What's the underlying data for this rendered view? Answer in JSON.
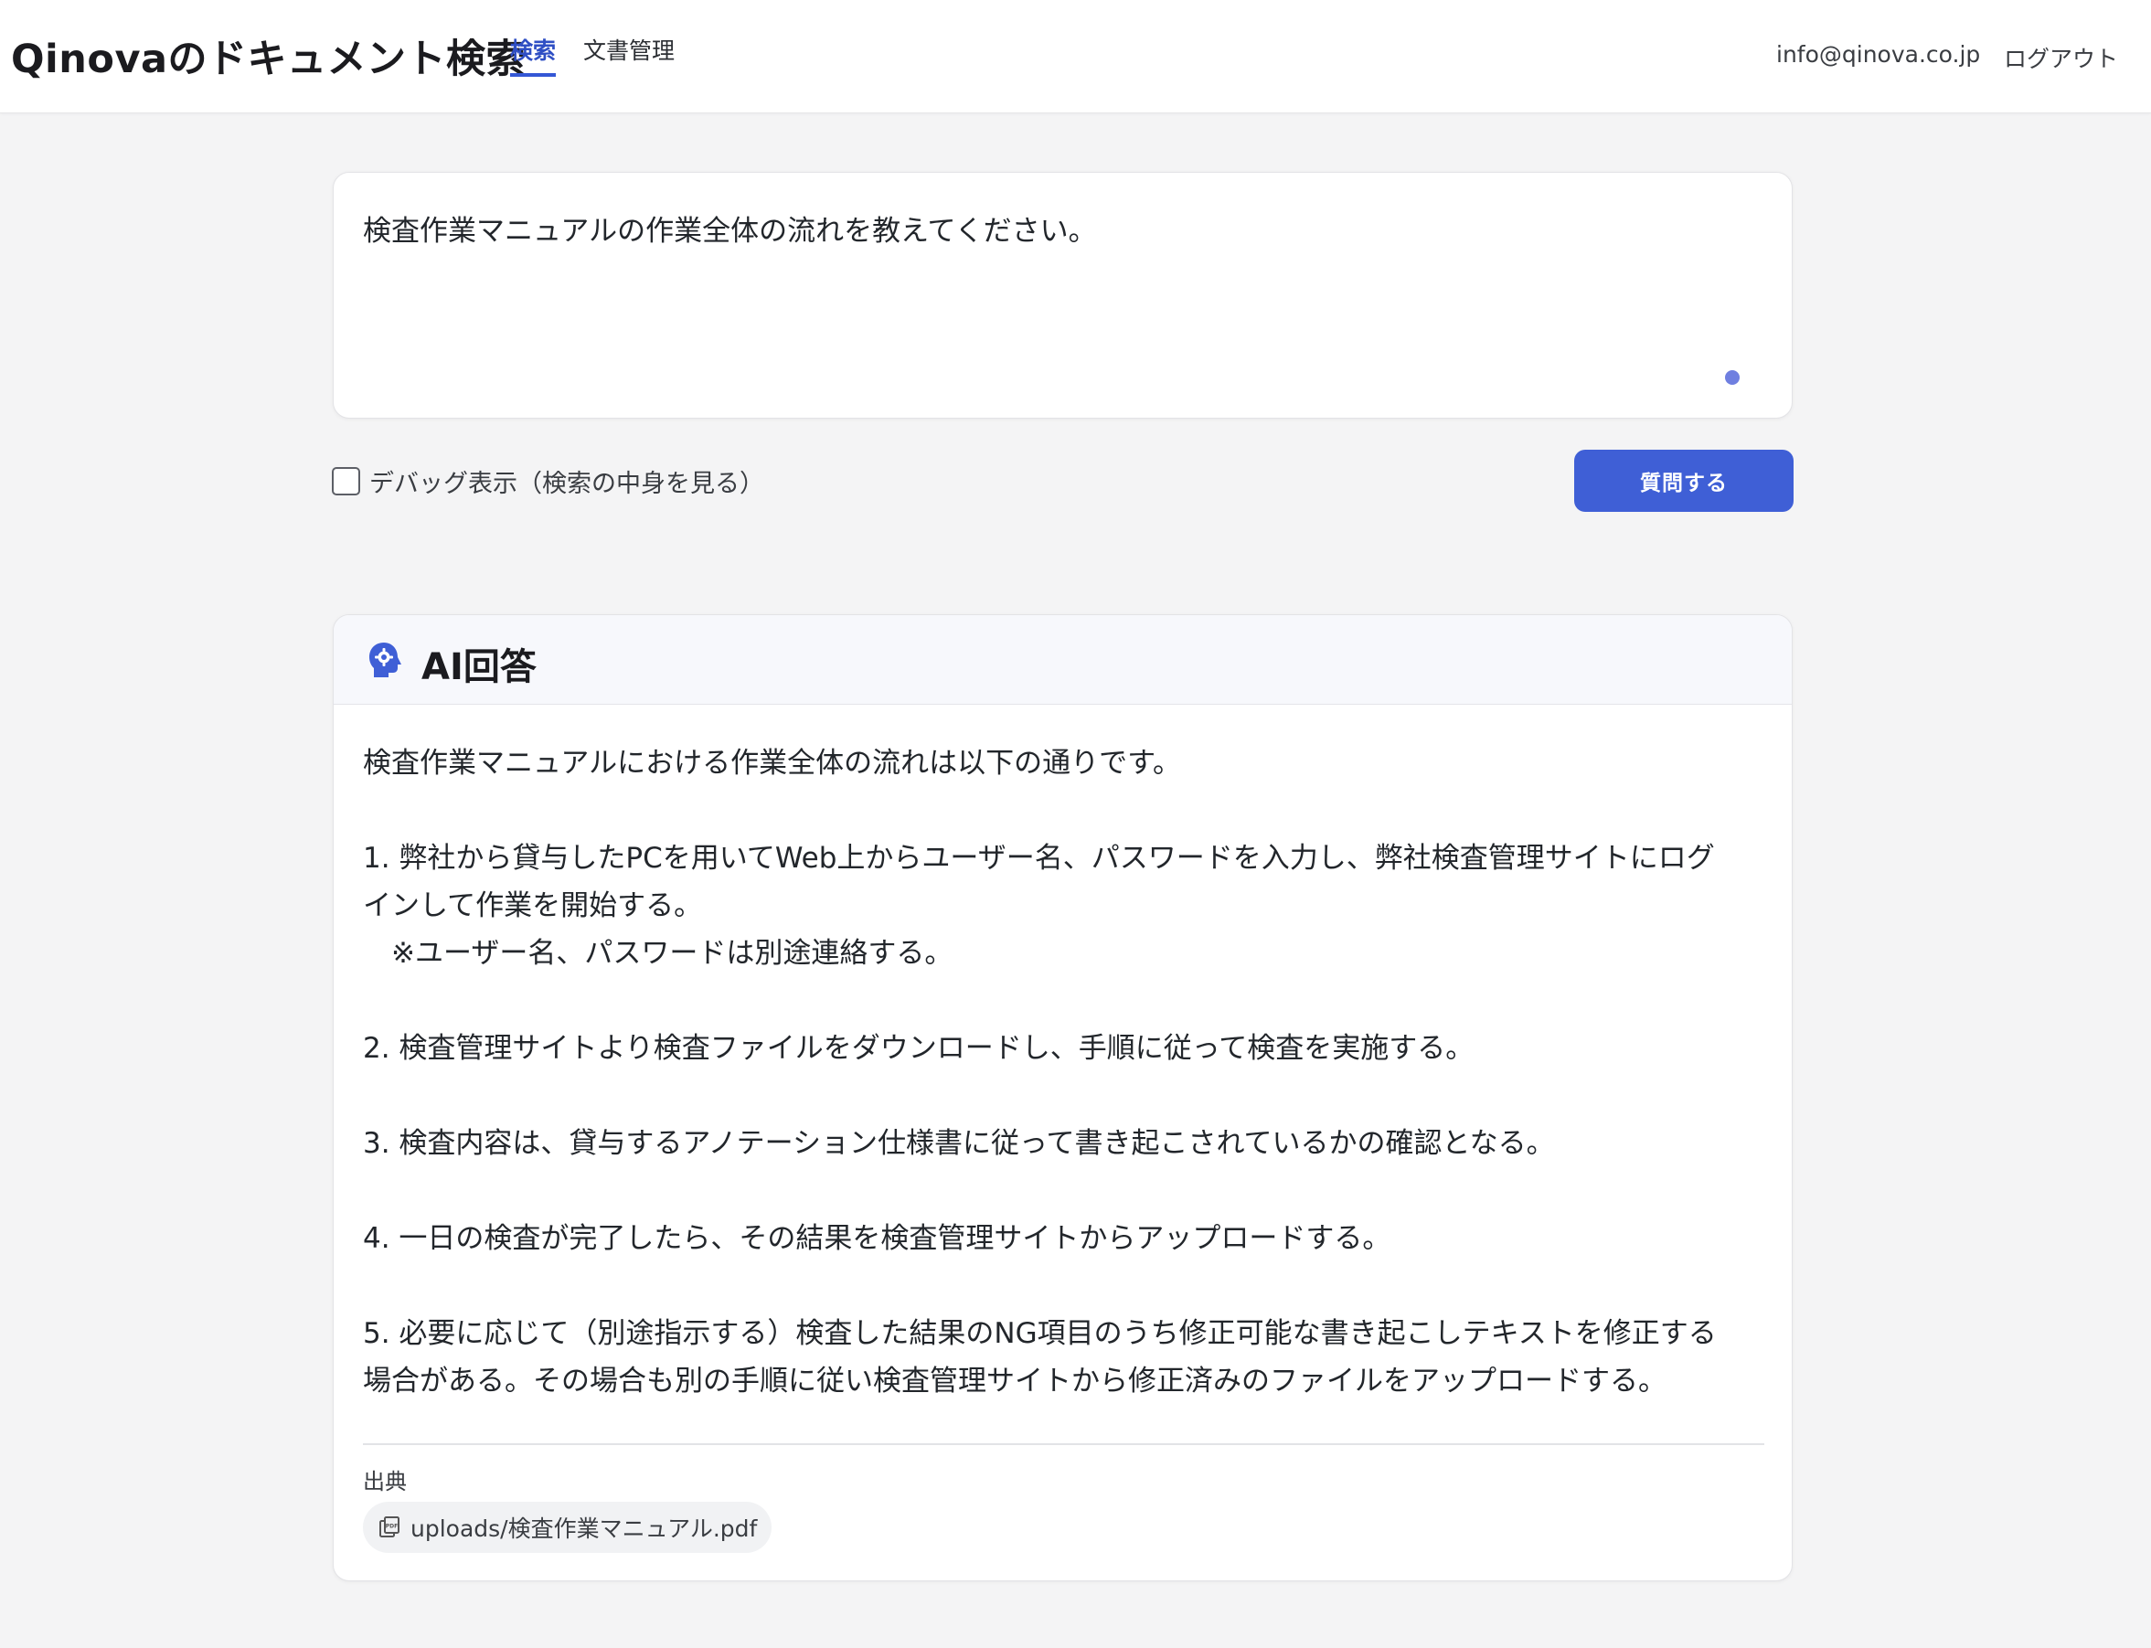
{
  "header": {
    "app_title": "Qinovaのドキュメント検索",
    "tabs": [
      {
        "label": "検索",
        "active": true
      },
      {
        "label": "文書管理",
        "active": false
      }
    ],
    "user_email": "info@qinova.co.jp",
    "logout_label": "ログアウト"
  },
  "query": {
    "text": "検査作業マニュアルの作業全体の流れを教えてください。"
  },
  "controls": {
    "debug_label": "デバッグ表示（検索の中身を見る）",
    "debug_checked": false,
    "ask_button_label": "質問する"
  },
  "answer": {
    "title": "AI回答",
    "lines": [
      "検査作業マニュアルにおける作業全体の流れは以下の通りです。",
      "",
      "1. 弊社から貸与したPCを用いてWeb上からユーザー名、パスワードを入力し、弊社検査管理サイトにログ",
      "インして作業を開始する。",
      "　※ユーザー名、パスワードは別途連絡する。",
      "",
      "2. 検査管理サイトより検査ファイルをダウンロードし、手順に従って検査を実施する。",
      "",
      "3. 検査内容は、貸与するアノテーション仕様書に従って書き起こされているかの確認となる。",
      "",
      "4. 一日の検査が完了したら、その結果を検査管理サイトからアップロードする。",
      "",
      "5. 必要に応じて（別途指示する）検査した結果のNG項目のうち修正可能な書き起こしテキストを修正する",
      "場合がある。その場合も別の手順に従い検査管理サイトから修正済みのファイルをアップロードする。"
    ],
    "sources_label": "出典",
    "sources": [
      "uploads/検査作業マニュアル.pdf"
    ]
  },
  "colors": {
    "accent": "#3f5fd6",
    "active_tab": "#2f4fc4",
    "background": "#f4f4f5"
  },
  "icons": {
    "ai": "ai-head-gear-icon",
    "source": "pdf-file-icon",
    "mic": "mic-dot-icon"
  }
}
